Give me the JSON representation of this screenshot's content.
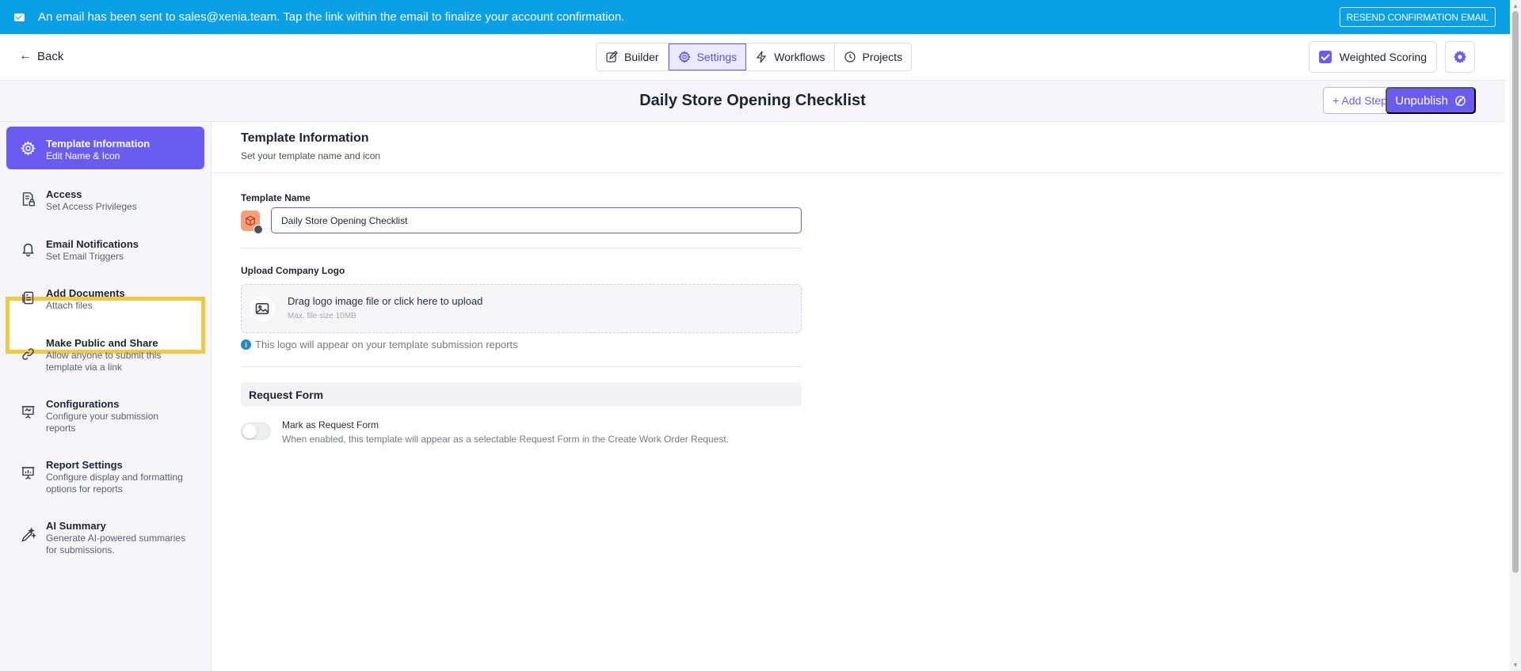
{
  "banner": {
    "message": "An email has been sent to sales@xenia.team. Tap the link within the email to finalize your account confirmation.",
    "resend_label": "RESEND CONFIRMATION EMAIL",
    "color": "#0aa0e6"
  },
  "header": {
    "back_label": "Back",
    "tabs": [
      {
        "label": "Builder",
        "icon": "pencil-icon"
      },
      {
        "label": "Settings",
        "icon": "gear-icon",
        "active": true
      },
      {
        "label": "Workflows",
        "icon": "lightning-icon"
      },
      {
        "label": "Projects",
        "icon": "clock-icon"
      }
    ],
    "weighted_scoring_label": "Weighted Scoring",
    "weighted_scoring_checked": true
  },
  "titlebar": {
    "title": "Daily Store Opening Checklist",
    "add_step_label": "+ Add Step",
    "unpublish_label": "Unpublish"
  },
  "sidebar": {
    "items": [
      {
        "title": "Template Information",
        "subtitle": "Edit Name & Icon",
        "icon": "gear-icon",
        "active": true
      },
      {
        "title": "Access",
        "subtitle": "Set Access Privileges",
        "icon": "document-lock-icon"
      },
      {
        "title": "Email Notifications",
        "subtitle": "Set Email Triggers",
        "icon": "bell-icon"
      },
      {
        "title": "Add Documents",
        "subtitle": "Attach files",
        "icon": "documents-icon"
      },
      {
        "title": "Make Public and Share",
        "subtitle": "Allow anyone to submit this template via a link",
        "icon": "link-icon"
      },
      {
        "title": "Configurations",
        "subtitle": "Configure your submission reports",
        "icon": "presentation-icon"
      },
      {
        "title": "Report Settings",
        "subtitle": "Configure display and formatting options for reports",
        "icon": "presentation-chart-icon"
      },
      {
        "title": "AI Summary",
        "subtitle": "Generate AI-powered summaries for submissions.",
        "icon": "sparkle-pen-icon"
      }
    ]
  },
  "main": {
    "section_title": "Template Information",
    "section_subtitle": "Set your template name and icon",
    "template_name_label": "Template Name",
    "template_name_value": "Daily Store Opening Checklist",
    "upload_label": "Upload Company Logo",
    "upload_main": "Drag logo image file or click here to upload",
    "upload_sub": "Max. file size 10MB",
    "upload_info": "This logo will appear on your template submission reports",
    "request_form_heading": "Request Form",
    "request_form_toggle_label": "Mark as Request Form",
    "request_form_toggle_on": false,
    "request_form_desc": "When enabled, this template will appear as a selectable Request Form in the Create Work Order Request."
  },
  "colors": {
    "accent": "#6a5cf1",
    "highlight": "#f5c842"
  }
}
